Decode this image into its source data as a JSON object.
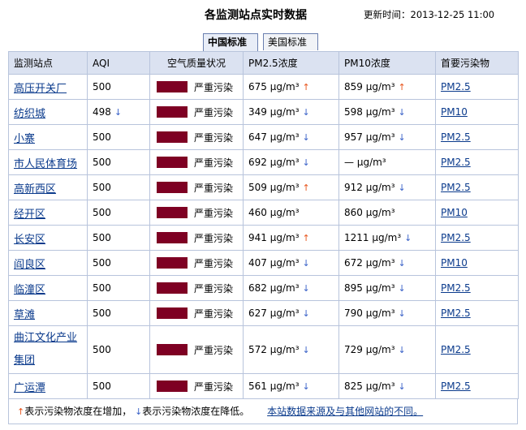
{
  "header": {
    "title": "各监测站点实时数据",
    "update_label": "更新时间：2013-12-25 11:00"
  },
  "tabs": [
    {
      "label": "中国标准",
      "active": true
    },
    {
      "label": "美国标准",
      "active": false
    }
  ],
  "table": {
    "columns": [
      "监测站点",
      "AQI",
      "空气质量状况",
      "PM2.5浓度",
      "PM10浓度",
      "首要污染物"
    ],
    "quality_color": "#7e0023",
    "rows": [
      {
        "station": "高压开关厂",
        "aqi": "500",
        "aqi_trend": "",
        "quality": "严重污染",
        "pm25": "675 μg/m³",
        "pm25_trend": "up",
        "pm10": "859 μg/m³",
        "pm10_trend": "up",
        "primary": "PM2.5"
      },
      {
        "station": "纺织城",
        "aqi": "498",
        "aqi_trend": "down",
        "quality": "严重污染",
        "pm25": "349 μg/m³",
        "pm25_trend": "down",
        "pm10": "598 μg/m³",
        "pm10_trend": "down",
        "primary": "PM10"
      },
      {
        "station": "小寨",
        "aqi": "500",
        "aqi_trend": "",
        "quality": "严重污染",
        "pm25": "647 μg/m³",
        "pm25_trend": "down",
        "pm10": "957 μg/m³",
        "pm10_trend": "down",
        "primary": "PM2.5"
      },
      {
        "station": "市人民体育场",
        "aqi": "500",
        "aqi_trend": "",
        "quality": "严重污染",
        "pm25": "692 μg/m³",
        "pm25_trend": "down",
        "pm10": "— μg/m³",
        "pm10_trend": "",
        "primary": "PM2.5"
      },
      {
        "station": "高新西区",
        "aqi": "500",
        "aqi_trend": "",
        "quality": "严重污染",
        "pm25": "509 μg/m³",
        "pm25_trend": "up",
        "pm10": "912 μg/m³",
        "pm10_trend": "down",
        "primary": "PM2.5"
      },
      {
        "station": "经开区",
        "aqi": "500",
        "aqi_trend": "",
        "quality": "严重污染",
        "pm25": "460 μg/m³",
        "pm25_trend": "",
        "pm10": "860 μg/m³",
        "pm10_trend": "",
        "primary": "PM10"
      },
      {
        "station": "长安区",
        "aqi": "500",
        "aqi_trend": "",
        "quality": "严重污染",
        "pm25": "941 μg/m³",
        "pm25_trend": "up",
        "pm10": "1211 μg/m³",
        "pm10_trend": "down",
        "primary": "PM2.5"
      },
      {
        "station": "阎良区",
        "aqi": "500",
        "aqi_trend": "",
        "quality": "严重污染",
        "pm25": "407 μg/m³",
        "pm25_trend": "down",
        "pm10": "672 μg/m³",
        "pm10_trend": "down",
        "primary": "PM10"
      },
      {
        "station": "临潼区",
        "aqi": "500",
        "aqi_trend": "",
        "quality": "严重污染",
        "pm25": "682 μg/m³",
        "pm25_trend": "down",
        "pm10": "895 μg/m³",
        "pm10_trend": "down",
        "primary": "PM2.5"
      },
      {
        "station": "草滩",
        "aqi": "500",
        "aqi_trend": "",
        "quality": "严重污染",
        "pm25": "627 μg/m³",
        "pm25_trend": "down",
        "pm10": "790 μg/m³",
        "pm10_trend": "down",
        "primary": "PM2.5"
      },
      {
        "station": "曲江文化产业集团",
        "aqi": "500",
        "aqi_trend": "",
        "quality": "严重污染",
        "pm25": "572 μg/m³",
        "pm25_trend": "down",
        "pm10": "729 μg/m³",
        "pm10_trend": "down",
        "primary": "PM2.5"
      },
      {
        "station": "广运潭",
        "aqi": "500",
        "aqi_trend": "",
        "quality": "严重污染",
        "pm25": "561 μg/m³",
        "pm25_trend": "down",
        "pm10": "825 μg/m³",
        "pm10_trend": "down",
        "primary": "PM2.5"
      }
    ]
  },
  "legend": {
    "up_text": "表示污染物浓度在增加，",
    "down_text": "表示污染物浓度在降低。",
    "link_text": "本站数据来源及与其他网站的不同。",
    "up_icon": "arrow-up-icon",
    "down_icon": "arrow-down-icon",
    "up_color": "#e8551c",
    "down_color": "#3a62c8"
  }
}
